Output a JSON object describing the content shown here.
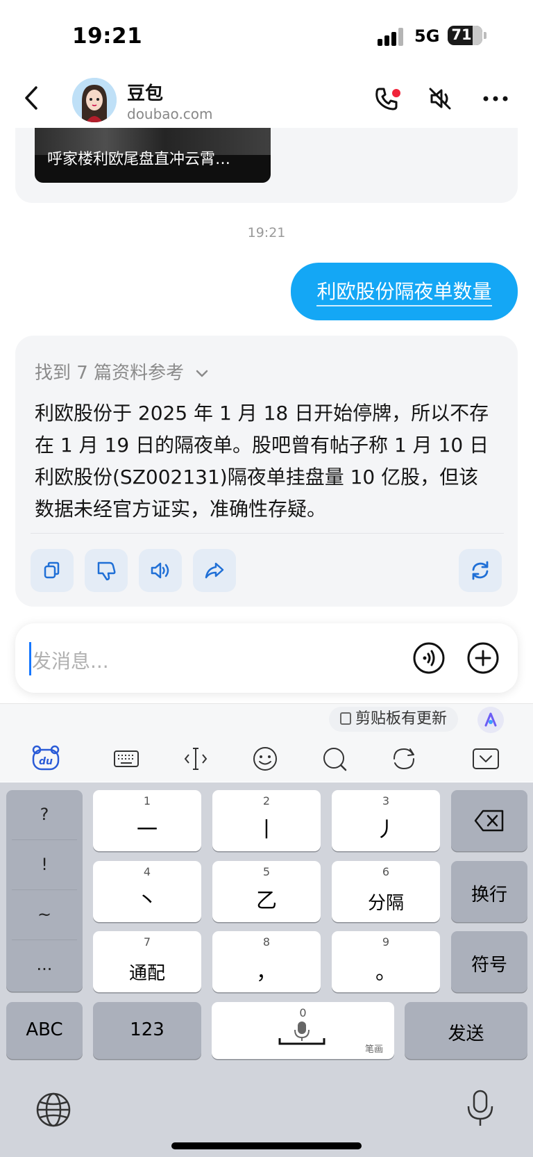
{
  "status_bar": {
    "time": "19:21",
    "network": "5G",
    "battery": "71",
    "battery_level": 0.71
  },
  "header": {
    "name": "豆包",
    "domain": "doubao.com"
  },
  "chat": {
    "previous_card_caption": "呼家楼利欧尾盘直冲云霄…",
    "timestamp": "19:21",
    "user_message": "利欧股份隔夜单数量",
    "references": "找到 7 篇资料参考",
    "answer_lines": [
      "利欧股份于 2025 年 1 月 18 日开始停牌，所以不存",
      "在 1 月 19 日的隔夜单。股吧曾有帖子称 1 月 10 日",
      "利欧股份(SZ002131)隔夜单挂盘量 10 亿股，但该",
      "数据未经官方证实，准确性存疑。"
    ]
  },
  "input": {
    "placeholder": "发消息..."
  },
  "keyboard": {
    "clipboard_notice": "剪贴板有更新",
    "side_symbols": [
      "?",
      "!",
      "~",
      "..."
    ],
    "keys": [
      {
        "num": "1",
        "glyph": "一"
      },
      {
        "num": "2",
        "glyph": "丨"
      },
      {
        "num": "3",
        "glyph": "丿"
      },
      {
        "num": "4",
        "glyph": "丶"
      },
      {
        "num": "5",
        "glyph": "乙"
      },
      {
        "num": "6",
        "glyph": "分隔"
      },
      {
        "num": "7",
        "glyph": "通配"
      },
      {
        "num": "8",
        "glyph": "，"
      },
      {
        "num": "9",
        "glyph": "。"
      }
    ],
    "newline": "换行",
    "symbols": "符号",
    "abc": "ABC",
    "num123": "123",
    "space_num": "0",
    "space_label": "笔画",
    "send": "发送"
  }
}
